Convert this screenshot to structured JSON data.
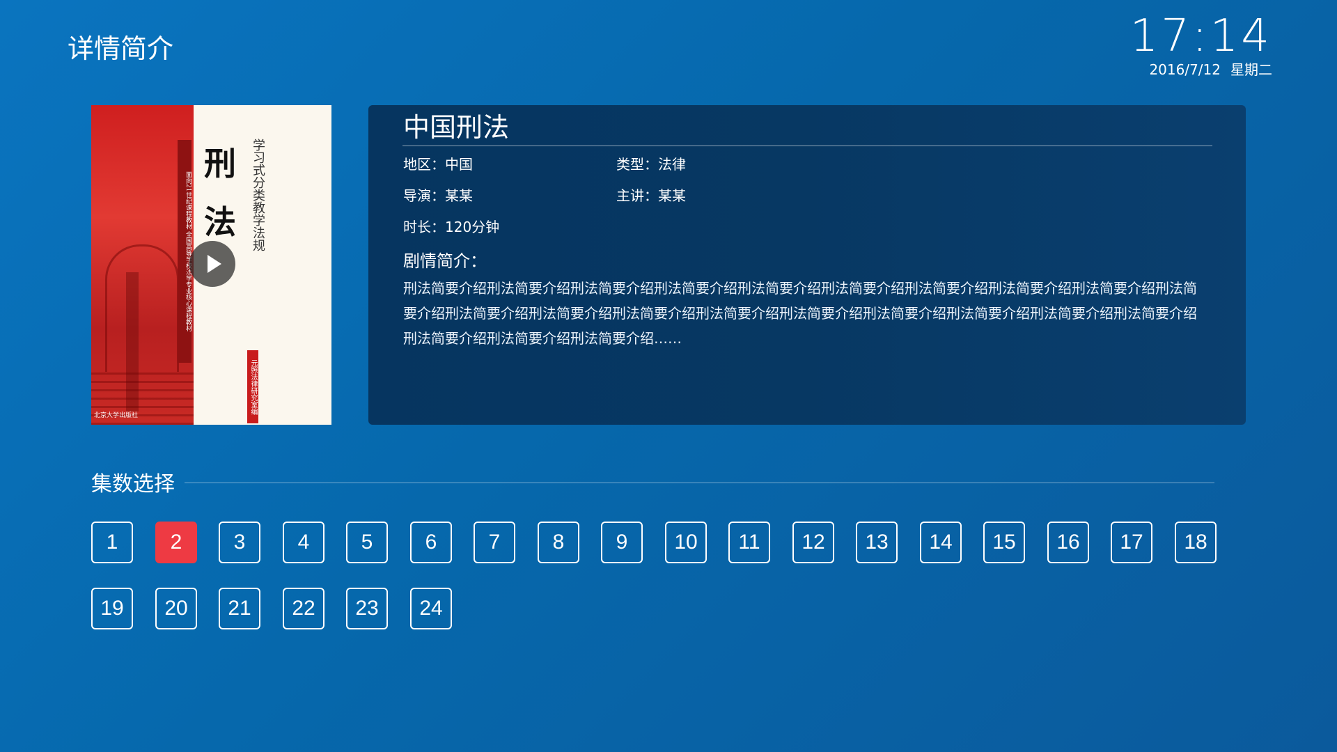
{
  "header": {
    "page_title": "详情简介",
    "time": "17:14",
    "date": "2016/7/12",
    "weekday": "星期二"
  },
  "poster": {
    "title_char_1": "刑",
    "title_char_2": "法",
    "series_label": "学习式分类教学法规",
    "spine_text": "面向21世纪课程教材 全国高等学校法学专业核心课程教材",
    "badge_text": "元照法律研究室编",
    "publisher": "北京大学出版社"
  },
  "detail": {
    "title": "中国刑法",
    "region_label": "地区：",
    "region": "中国",
    "type_label": "类型：",
    "type": "法律",
    "director_label": "导演：",
    "director": "某某",
    "lecturer_label": "主讲：",
    "lecturer": "某某",
    "duration_label": "时长：",
    "duration": "120分钟",
    "synopsis_label": "剧情简介：",
    "synopsis": "刑法简要介绍刑法简要介绍刑法简要介绍刑法简要介绍刑法简要介绍刑法简要介绍刑法简要介绍刑法简要介绍刑法简要介绍刑法简要介绍刑法简要介绍刑法简要介绍刑法简要介绍刑法简要介绍刑法简要介绍刑法简要介绍刑法简要介绍刑法简要介绍刑法简要介绍刑法简要介绍刑法简要介绍刑法简要介绍……"
  },
  "episodes": {
    "heading": "集数选择",
    "selected": "2",
    "items": [
      "1",
      "2",
      "3",
      "4",
      "5",
      "6",
      "7",
      "8",
      "9",
      "10",
      "11",
      "12",
      "13",
      "14",
      "15",
      "16",
      "17",
      "18",
      "19",
      "20",
      "21",
      "22",
      "23",
      "24"
    ]
  },
  "colors": {
    "background": "#0668ac",
    "panel": "#063560",
    "selected_episode": "#ee3a43"
  }
}
